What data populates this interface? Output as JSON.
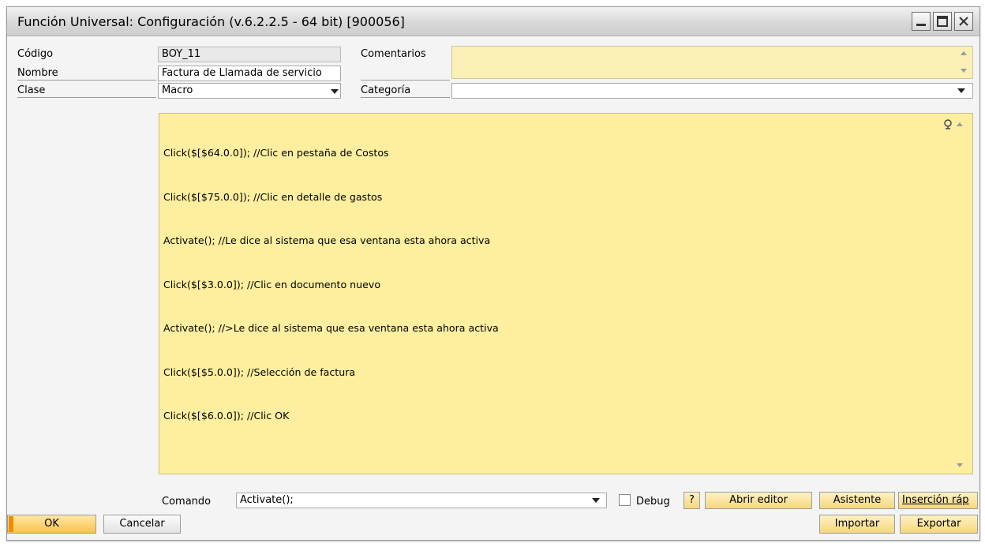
{
  "window": {
    "title": "Función Universal: Configuración (v.6.2.2.5 - 64 bit) [900056]"
  },
  "form": {
    "codigo_label": "Código",
    "codigo_value": "BOY_11",
    "nombre_label": "Nombre",
    "nombre_value": "Factura de Llamada de servicio",
    "clase_label": "Clase",
    "clase_value": "Macro",
    "comentarios_label": "Comentarios",
    "comentarios_value": "",
    "categoria_label": "Categoría",
    "categoria_value": ""
  },
  "editor": {
    "lines": [
      "Click($[$64.0.0]); //Clic en pestaña de Costos",
      "Click($[$75.0.0]); //Clic en detalle de gastos",
      "Activate(); //Le dice al sistema que esa ventana esta ahora activa",
      "Click($[$3.0.0]); //Clic en documento nuevo",
      "Activate(); //>Le dice al sistema que esa ventana esta ahora activa",
      "Click($[$5.0.0]); //Selección de factura",
      "Click($[$6.0.0]); //Clic OK"
    ]
  },
  "command_bar": {
    "comando_label": "Comando",
    "comando_value": "Activate();",
    "debug_label": "Debug",
    "debug_checked": false,
    "help_label": "?",
    "abrir_editor_label": "Abrir editor",
    "asistente_label": "Asistente",
    "insercion_label": "Inserción ráp"
  },
  "footer": {
    "ok_label": "OK",
    "cancelar_label": "Cancelar",
    "importar_label": "Importar",
    "exportar_label": "Exportar"
  },
  "colors": {
    "editor_bg": "#fdef9f",
    "button_accent": "#f08c00"
  }
}
